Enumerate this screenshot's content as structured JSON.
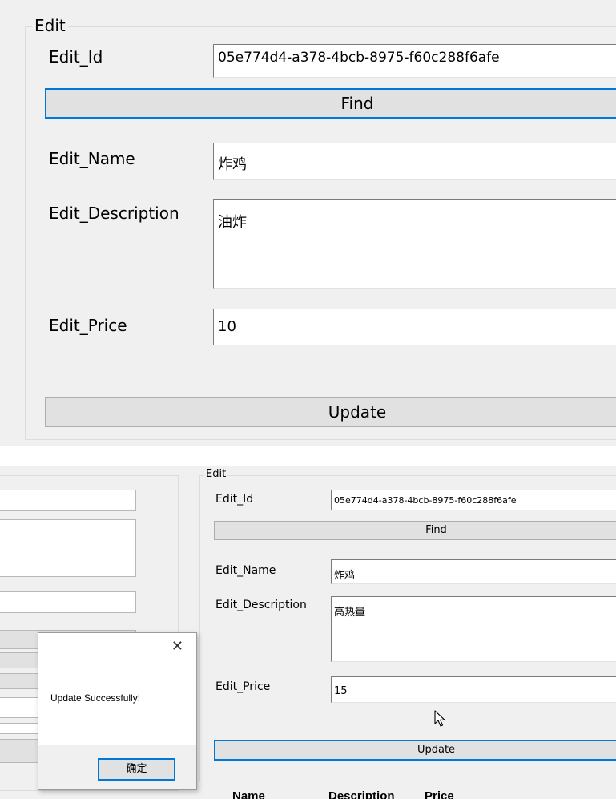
{
  "zoomed_form": {
    "group_title": "Edit",
    "edit_id_label": "Edit_Id",
    "edit_id_value": "05e774d4-a378-4bcb-8975-f60c288f6afe",
    "find_label": "Find",
    "edit_name_label": "Edit_Name",
    "edit_name_value": "炸鸡",
    "edit_description_label": "Edit_Description",
    "edit_description_value": "油炸",
    "edit_price_label": "Edit_Price",
    "edit_price_value": "10",
    "update_label": "Update"
  },
  "app_form": {
    "group_title": "Edit",
    "edit_id_label": "Edit_Id",
    "edit_id_value": "05e774d4-a378-4bcb-8975-f60c288f6afe",
    "find_label": "Find",
    "edit_name_label": "Edit_Name",
    "edit_name_value": "炸鸡",
    "edit_description_label": "Edit_Description",
    "edit_description_value": "高热量",
    "edit_price_label": "Edit_Price",
    "edit_price_value": "15",
    "update_label": "Update"
  },
  "dialog": {
    "message": "Update Successfully!",
    "ok_label": "确定",
    "close_glyph": "✕"
  },
  "grid": {
    "columns": [
      "Name",
      "Description",
      "Price"
    ]
  },
  "icons": {
    "cursor": "arrow-cursor-icon",
    "close": "close-icon"
  },
  "colors": {
    "window_bg": "#f0f0f0",
    "focus_border": "#0078d7",
    "button_bg": "#e1e1e1"
  }
}
